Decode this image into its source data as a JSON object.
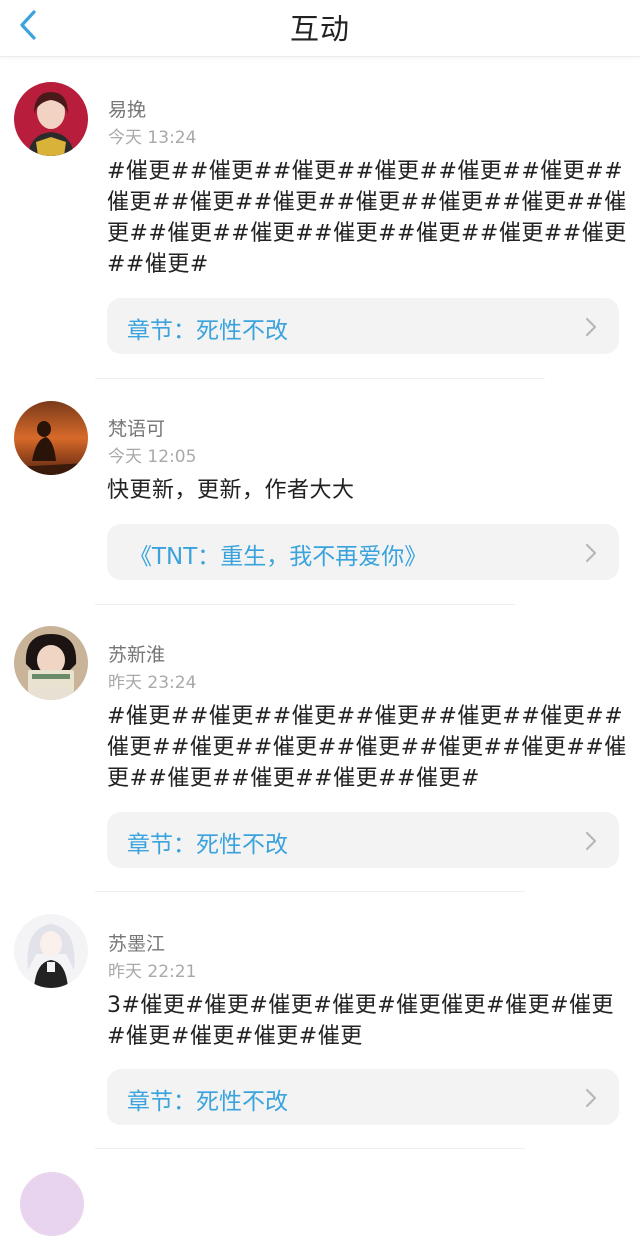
{
  "header": {
    "title": "互动",
    "back_icon": "chevron-left-icon",
    "accent_color": "#3aa3dd"
  },
  "items": [
    {
      "username": "易挽",
      "time": "今天 13:24",
      "content": "#催更##催更##催更##催更##催更##催更##催更##催更##催更##催更##催更##催更##催更##催更##催更##催更##催更##催更##催更##催更#",
      "link": "章节：死性不改",
      "chevron_icon": "chevron-right-icon"
    },
    {
      "username": "梵语可",
      "time": "今天 12:05",
      "content": "快更新，更新，作者大大",
      "link": "《TNT：重生，我不再爱你》",
      "chevron_icon": "chevron-right-icon"
    },
    {
      "username": "苏新淮",
      "time": "昨天 23:24",
      "content": "#催更##催更##催更##催更##催更##催更##催更##催更##催更##催更##催更##催更##催更##催更##催更##催更##催更#",
      "link": "章节：死性不改",
      "chevron_icon": "chevron-right-icon"
    },
    {
      "username": "苏墨江",
      "time": "昨天 22:21",
      "content": "3#催更#催更#催更#催更#催更催更#催更#催更#催更#催更#催更#催更",
      "link": "章节：死性不改",
      "chevron_icon": "chevron-right-icon"
    }
  ]
}
